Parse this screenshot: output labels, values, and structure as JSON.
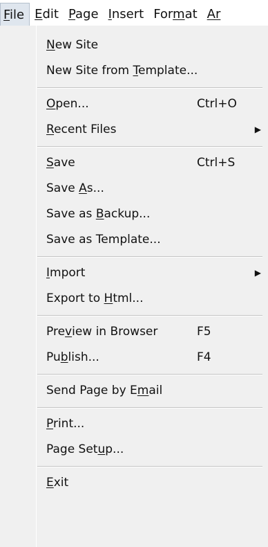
{
  "menubar": {
    "items": [
      {
        "pre": "",
        "u": "F",
        "post": "ile"
      },
      {
        "pre": "",
        "u": "E",
        "post": "dit"
      },
      {
        "pre": "",
        "u": "P",
        "post": "age"
      },
      {
        "pre": "",
        "u": "I",
        "post": "nsert"
      },
      {
        "pre": "For",
        "u": "m",
        "post": "at"
      },
      {
        "pre": "",
        "u": "Ar",
        "post": ""
      }
    ]
  },
  "file_menu": {
    "new_site": {
      "pre": "",
      "u": "N",
      "post": "ew Site"
    },
    "new_site_template": {
      "pre": "New Site from ",
      "u": "T",
      "post": "emplate..."
    },
    "open": {
      "pre": "",
      "u": "O",
      "post": "pen...",
      "shortcut": "Ctrl+O"
    },
    "recent_files": {
      "pre": "",
      "u": "R",
      "post": "ecent Files",
      "arrow": "▶"
    },
    "save": {
      "pre": "",
      "u": "S",
      "post": "ave",
      "shortcut": "Ctrl+S"
    },
    "save_as": {
      "pre": "Save ",
      "u": "A",
      "post": "s..."
    },
    "save_as_backup": {
      "pre": "Save as ",
      "u": "B",
      "post": "ackup..."
    },
    "save_as_template": {
      "pre": "Save as Template...",
      "u": "",
      "post": ""
    },
    "import": {
      "pre": "",
      "u": "I",
      "post": "mport",
      "arrow": "▶"
    },
    "export_html": {
      "pre": "Export to ",
      "u": "H",
      "post": "tml..."
    },
    "preview": {
      "pre": "Pre",
      "u": "v",
      "post": "iew in Browser",
      "shortcut": "F5"
    },
    "publish": {
      "pre": "Pu",
      "u": "b",
      "post": "lish...",
      "shortcut": "F4"
    },
    "send_email": {
      "pre": "Send Page by E",
      "u": "m",
      "post": "ail"
    },
    "print": {
      "pre": "",
      "u": "P",
      "post": "rint..."
    },
    "page_setup": {
      "pre": "Page Set",
      "u": "u",
      "post": "p..."
    },
    "exit": {
      "pre": "",
      "u": "E",
      "post": "xit"
    }
  }
}
